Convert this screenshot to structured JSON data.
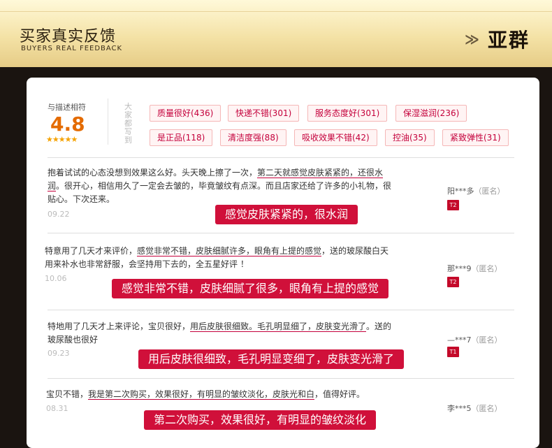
{
  "header": {
    "title": "买家真实反馈",
    "subtitle": "BUYERS REAL FEEDBACK",
    "brand": "亚群"
  },
  "rating": {
    "label": "与描述相符",
    "score": "4.8",
    "stars": "★★★★★",
    "stars_value": 5,
    "tags_caption": "大家都写到"
  },
  "tags": [
    "质量很好(436)",
    "快递不错(301)",
    "服务态度好(301)",
    "保湿滋润(236)",
    "是正品(118)",
    "清洁度强(88)",
    "吸收效果不错(42)",
    "控油(35)",
    "紧致弹性(31)"
  ],
  "reviews": [
    {
      "segments": [
        "抱着试试的心态没想到效果这么好。头天晚上擦了一次，",
        "第二天就感觉皮肤紧紧的，还很水",
        "",
        "润",
        "。很开心，相信用久了一定会去皱的，毕竟皱纹有点深。而且店家还给了许多的小礼物，很",
        "",
        "贴心。下次还来。"
      ],
      "date": "09.22",
      "user": "阳***多",
      "anon": "（匿名）",
      "level": "T2",
      "callout": "感觉皮肤紧紧的，很水润"
    },
    {
      "segments": [
        "特意用了几天才来评价，",
        "感觉非常不错，皮肤细腻许多，眼角有上提的感觉",
        "，送的玻尿酸白天",
        "用来补水也非常舒服，会坚持用下去的，全五星好评 ！"
      ],
      "date": "10.06",
      "user": "那***9",
      "anon": "（匿名）",
      "level": "T2",
      "callout": "感觉非常不错，皮肤细腻了很多，眼角有上提的感觉"
    },
    {
      "segments": [
        "特地用了几天才上来评论，宝贝很好，",
        "用后皮肤很细致。毛孔明显细了，皮肤变光滑了",
        "。送的",
        "玻尿酸也很好"
      ],
      "date": "09.23",
      "user": "—***7",
      "anon": "（匿名）",
      "level": "T1",
      "callout": "用后皮肤很细致，毛孔明显变细了，皮肤变光滑了"
    },
    {
      "segments": [
        "宝贝不错，",
        "我是第二次购买，效果很好，有明显的皱纹淡化，皮肤光和白",
        "，值得好评。"
      ],
      "date": "08.31",
      "user": "李***5",
      "anon": "（匿名）",
      "level": "",
      "callout": "第二次购买，效果很好，有明显的皱纹淡化"
    }
  ],
  "colors": {
    "accent": "#d0103a",
    "score": "#e46b00",
    "star": "#f5a200",
    "tag_text": "#c4003b"
  }
}
